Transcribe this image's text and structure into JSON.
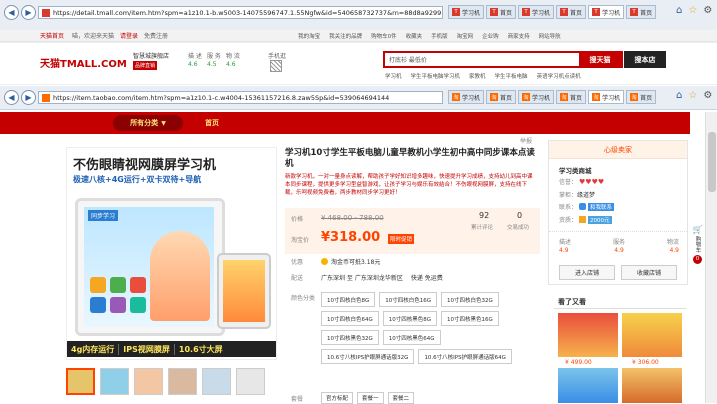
{
  "browser1": {
    "url": "https://detail.tmall.com/item.htm?spm=a1z10.1-b.w5003-14075596747.1.55Ngfw&id=540658732737&rn=88d8a929958bc7b40",
    "tabs": [
      "学习机",
      "首页",
      "学习机",
      "首页",
      "学习机",
      "首页"
    ],
    "commands": [
      "页面(P)",
      "安全(S)",
      "工具(O)"
    ],
    "menu": [
      "文件(F)",
      "编辑(E)",
      "查看(V)",
      "收藏夹(A)",
      "工具(T)",
      "帮助(H)"
    ]
  },
  "tmall_bar": {
    "links": [
      "天猫首页",
      "喵，欢迎来天猫",
      "请登录",
      "免费注册"
    ],
    "right": [
      "我的淘宝",
      "我关注的品牌",
      "购物车0件",
      "收藏夹",
      "手机版",
      "淘宝网",
      "企业购",
      "商家支持",
      "网站导航"
    ]
  },
  "tmall_header": {
    "logo": "天猫TMALL.COM",
    "store_name": "智慧城旗舰店",
    "store_badge": "品牌直销",
    "rating_labels": [
      "描 述",
      "服 务",
      "物 流"
    ],
    "ratings": [
      "4.6",
      "4.5",
      "4.6"
    ],
    "phone_label": "手机逛",
    "search_value": "打底衫 最低价",
    "search_btn_tmall": "搜天猫",
    "search_btn_store": "搜本店",
    "hot_words": [
      "学习机",
      "学生平板电脑学习机",
      "家教机",
      "学生平板电脑",
      "英语学习机点读机"
    ]
  },
  "browser2": {
    "url": "https://item.taobao.com/item.htm?spm=a1z10.1-c.w4004-15361157216.8.zaw5Sp&id=539064694144",
    "tabs": [
      "学习机",
      "首页",
      "学习机",
      "首页",
      "学习机",
      "首页"
    ]
  },
  "nav": {
    "all_categories": "所有分类",
    "home": "首页"
  },
  "banner": {
    "title": "不伤眼睛视网膜屏学习机",
    "subtitle": "极速八核+4G运行+双卡双待+导航",
    "device_title": "同步学习",
    "bottom_tags": [
      "4g内存运行",
      "IPS视网膜屏",
      "10.6寸大屏"
    ]
  },
  "product": {
    "title": "学习机10寸学生平板电脑儿童早教机小学生初中高中同步课本点读机",
    "desc": "新款学习机，一对一量身点读解，帮助孩子学好知识增多趣味，快速提升学习成绩，支持幼儿到高中课本同步课程，提供更多学习型益智游戏，让孩子学习与娱乐有效结合！不伤眼视网膜屏，支持在线下载，乐呵视频免费看，两步教材同步学习更好！",
    "share": "举报",
    "price_label": "价格",
    "original_price": "¥ 468.00 - 788.00",
    "taobao_price_label": "淘宝价",
    "price": "¥318.00",
    "price_tag": "限时促销",
    "reviews_count": "92",
    "reviews_label": "累计评论",
    "deals_count": "0",
    "deals_label": "交易成功",
    "promo_label": "优惠",
    "promo_text": "淘金币可抵3.18元",
    "ship_label": "配送",
    "ship_text": "广东深圳 至  广东深圳龙华新区",
    "ship_fee": "快递 免运费",
    "color_label": "颜色分类",
    "colors": [
      "10寸四核白色8G",
      "10寸四核白色16G",
      "10寸四核白色32G",
      "10寸四核白色64G",
      "10寸四核黑色8G",
      "10寸四核黑色16G",
      "10寸四核黑色32G",
      "10寸四核黑色64G",
      "10.6寸八核IPS护眼屏通话版32G",
      "10.6寸八核IPS护眼屏通话版64G"
    ],
    "set_label": "套餐",
    "sets": [
      "官方标配",
      "套餐一",
      "套餐二"
    ]
  },
  "seller": {
    "header": "心级卖家",
    "shop_name": "学习类商城",
    "credit_label": "信誉：",
    "owner_label": "掌柜：",
    "owner": "缘道梦",
    "contact_label": "联系：",
    "contact": "和我联系",
    "quality_label": "资质：",
    "deposit": "2000元",
    "score_labels": [
      "描述",
      "服务",
      "物流"
    ],
    "scores": [
      "4.9",
      "4.9",
      "4.9"
    ],
    "enter_shop": "进入店铺",
    "fav_shop": "收藏店铺",
    "related_title": "看了又看",
    "related_prices": [
      "¥ 499.00",
      "¥ 306.00"
    ]
  },
  "sidebar": {
    "cart_label": "购物车",
    "cart_count": "0"
  },
  "colors": {
    "tmall_red": "#c40000",
    "price_orange": "#ff4400",
    "nav_bg": "#c40000",
    "nav_button": "#f5c400"
  }
}
